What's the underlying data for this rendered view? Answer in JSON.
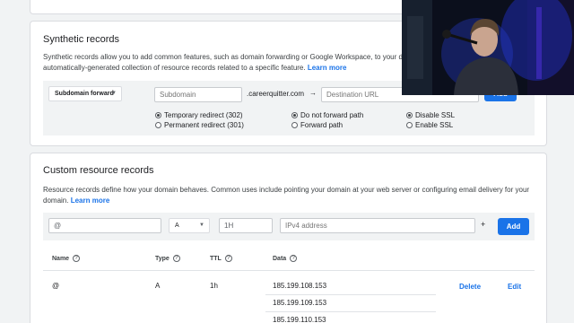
{
  "synthetic": {
    "title": "Synthetic records",
    "desc": "Synthetic records allow you to add common features, such as domain forwarding or Google Workspace, to your domain. A synthetic record is an automatically-generated collection of resource records related to a specific feature.",
    "learn_more": "Learn more",
    "type_select": "Subdomain forward",
    "subdomain_placeholder": "Subdomain",
    "domain_suffix": ".careerquitter.com",
    "arrow": "→",
    "destination_placeholder": "Destination URL",
    "add_label": "Add",
    "redirect_options": [
      {
        "label": "Temporary redirect (302)",
        "checked": true
      },
      {
        "label": "Permanent redirect (301)",
        "checked": false
      }
    ],
    "path_options": [
      {
        "label": "Do not forward path",
        "checked": true
      },
      {
        "label": "Forward path",
        "checked": false
      }
    ],
    "ssl_options": [
      {
        "label": "Disable SSL",
        "checked": true
      },
      {
        "label": "Enable SSL",
        "checked": false
      }
    ]
  },
  "custom": {
    "title": "Custom resource records",
    "desc": "Resource records define how your domain behaves. Common uses include pointing your domain at your web server or configuring email delivery for your domain.",
    "learn_more": "Learn more",
    "name_value": "@",
    "type_value": "A",
    "ttl_value": "1H",
    "data_placeholder": "IPv4 address",
    "plus": "+",
    "add_label": "Add",
    "columns": {
      "name": "Name",
      "type": "Type",
      "ttl": "TTL",
      "data": "Data"
    },
    "help_glyph": "?",
    "record": {
      "name": "@",
      "type": "A",
      "ttl": "1h",
      "data": [
        "185.199.108.153",
        "185.199.109.153",
        "185.199.110.153"
      ],
      "delete_label": "Delete",
      "edit_label": "Edit"
    }
  },
  "colors": {
    "accent": "#1a73e8",
    "page_bg": "#f1f3f4"
  }
}
